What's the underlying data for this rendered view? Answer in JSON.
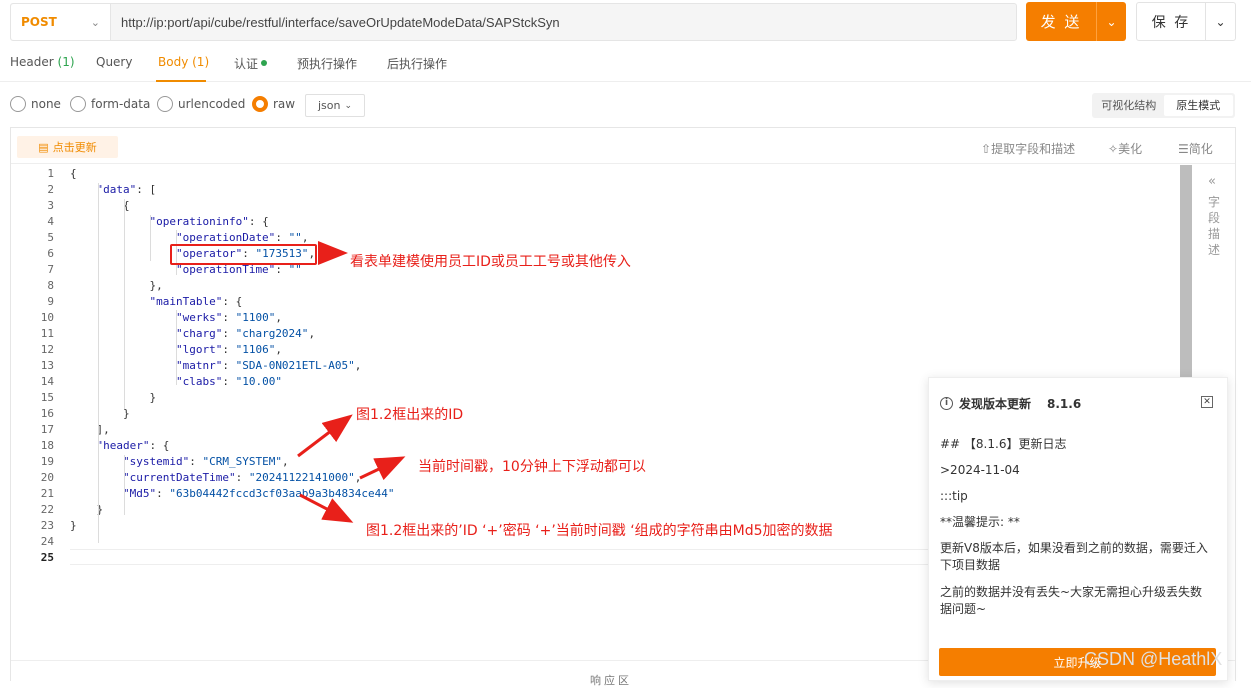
{
  "request": {
    "method": "POST",
    "url": "http://ip:port/api/cube/restful/interface/saveOrUpdateModeData/SAPStckSyn",
    "send_label": "发 送",
    "save_label": "保 存"
  },
  "tabs": [
    {
      "label": "Header",
      "count": "(1)"
    },
    {
      "label": "Query",
      "count": ""
    },
    {
      "label": "Body",
      "count": "(1)"
    },
    {
      "label": "认证",
      "count": ""
    },
    {
      "label": "预执行操作",
      "count": ""
    },
    {
      "label": "后执行操作",
      "count": ""
    }
  ],
  "body_types": [
    "none",
    "form-data",
    "urlencoded",
    "raw"
  ],
  "body_type_selected": "raw",
  "format": "json",
  "view_modes": [
    "可视化结构",
    "原生模式"
  ],
  "toolbar": {
    "update": "点击更新",
    "extract": "提取字段和描述",
    "beautify": "美化",
    "simplify": "简化"
  },
  "side_panel": {
    "label": "字段描述"
  },
  "code_lines": [
    "{",
    "    \"data\": [",
    "        {",
    "            \"operationinfo\": {",
    "                \"operationDate\": \"\",",
    "                \"operator\": \"173513\",",
    "                \"operationTime\": \"\"",
    "            },",
    "            \"mainTable\": {",
    "                \"werks\": \"1100\",",
    "                \"charg\": \"charg2024\",",
    "                \"lgort\": \"1106\",",
    "                \"matnr\": \"SDA-0N021ETL-A05\",",
    "                \"clabs\": \"10.00\"",
    "            }",
    "        }",
    "    ],",
    "    \"header\": {",
    "        \"systemid\": \"CRM_SYSTEM\",",
    "        \"currentDateTime\": \"20241122141000\",",
    "        \"Md5\": \"63b04442fccd3cf03aab9a3b4834ce44\"",
    "    }",
    "}",
    "",
    ""
  ],
  "annotations": {
    "operator_note": "看表单建模使用员工ID或员工工号或其他传入",
    "systemid_note": "图1.2框出来的ID",
    "time_note": "当前时间戳，10分钟上下浮动都可以",
    "md5_note": "图1.2框出来的’ID ‘+’密码 ‘+’当前时间戳 ‘组成的字符串由Md5加密的数据"
  },
  "popup": {
    "title": "发现版本更新",
    "version": "8.1.6",
    "lines": [
      "## 【8.1.6】更新日志",
      ">2024-11-04",
      ":::tip",
      "**温馨提示: **",
      "更新V8版本后，如果没看到之前的数据，需要迁入下项目数据",
      "之前的数据并没有丢失~大家无需担心升级丢失数据问题~"
    ],
    "button": "立即升级"
  },
  "response_label": "响应区",
  "watermark": "CSDN @HeathlX",
  "colors": {
    "accent": "#f57e00",
    "annotation": "#e8201a",
    "string": "#0451a5",
    "key": "#1a1aa6"
  }
}
